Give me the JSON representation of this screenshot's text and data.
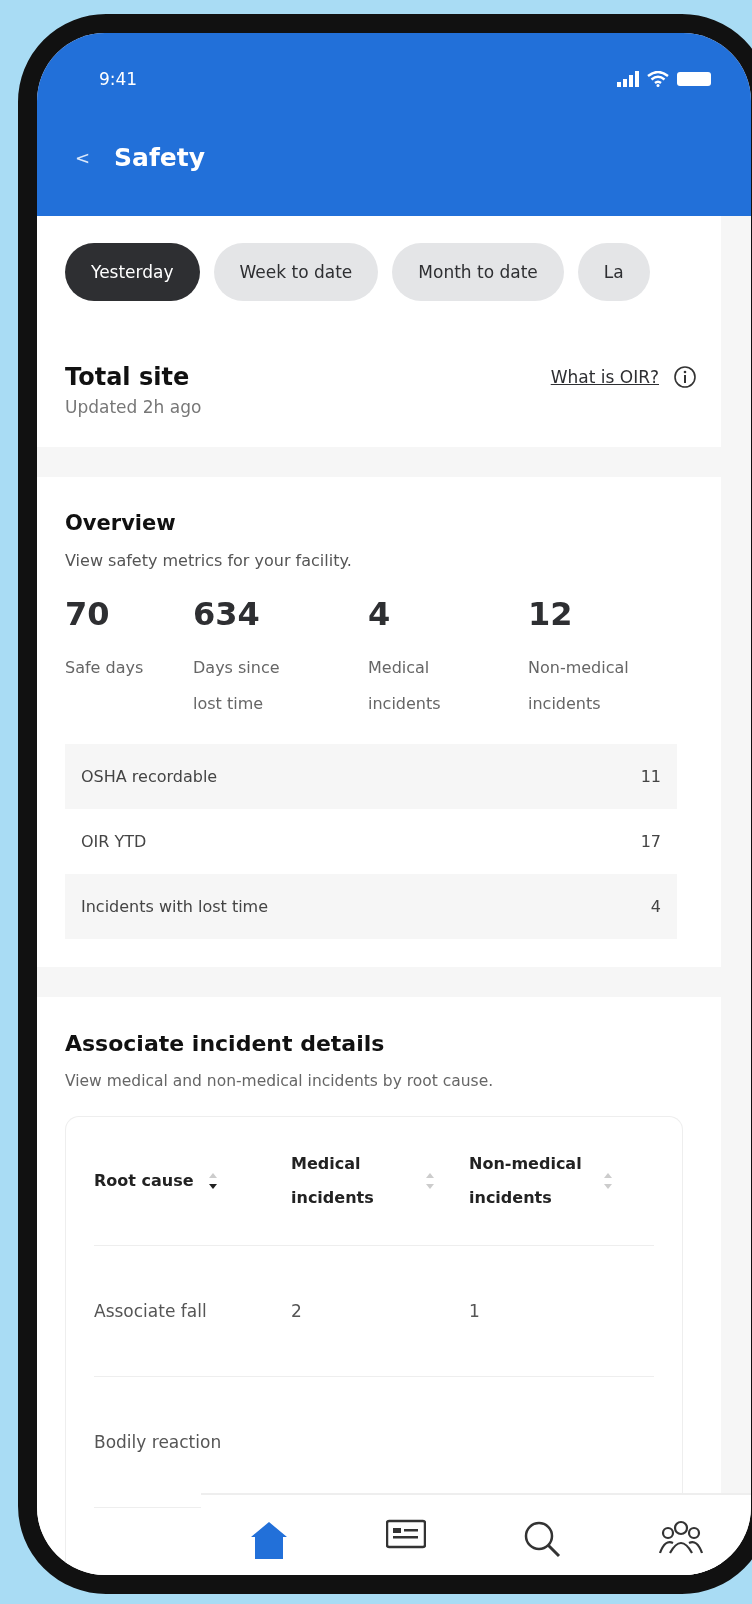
{
  "status_bar": {
    "time": "9:41"
  },
  "header": {
    "back": "<",
    "title": "Safety"
  },
  "filters": [
    {
      "label": "Yesterday",
      "selected": true
    },
    {
      "label": "Week to date",
      "selected": false
    },
    {
      "label": "Month to date",
      "selected": false
    },
    {
      "label": "La",
      "selected": false
    }
  ],
  "summary": {
    "title": "Total site",
    "updated": "Updated 2h ago",
    "link": "What is OIR?"
  },
  "overview": {
    "title": "Overview",
    "subtitle": "View safety metrics for your facility.",
    "stats": [
      {
        "value": "70",
        "label": "Safe days"
      },
      {
        "value": "634",
        "label": "Days since lost time"
      },
      {
        "value": "4",
        "label": "Medical incidents"
      },
      {
        "value": "12",
        "label": "Non-medical incidents"
      }
    ],
    "metrics": [
      {
        "label": "OSHA recordable",
        "value": "11"
      },
      {
        "label": "OIR YTD",
        "value": "17"
      },
      {
        "label": "Incidents with lost time",
        "value": "4"
      }
    ]
  },
  "incidents": {
    "title": "Associate incident details",
    "subtitle": "View medical and non-medical incidents by root cause.",
    "columns": [
      {
        "label": "Root cause",
        "sorted": true
      },
      {
        "label": "Medical incidents",
        "sorted": false
      },
      {
        "label": "Non-medical incidents",
        "sorted": false
      }
    ],
    "rows": [
      {
        "cells": [
          "Associate fall",
          "2",
          "1"
        ]
      },
      {
        "cells": [
          "Bodily reaction"
        ]
      }
    ]
  },
  "bottom_nav": [
    {
      "kind": "home",
      "selected": true
    },
    {
      "kind": "card",
      "selected": false
    },
    {
      "kind": "search",
      "selected": false
    },
    {
      "kind": "people",
      "selected": false
    }
  ]
}
